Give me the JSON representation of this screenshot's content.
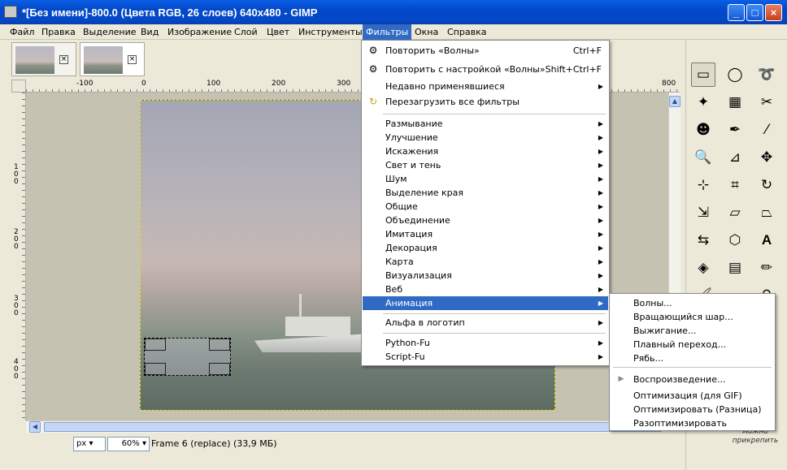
{
  "window": {
    "title": "*[Без имени]-800.0 (Цвета RGB, 26 слоев) 640x480 - GIMP",
    "controls": [
      "_",
      "□",
      "×"
    ]
  },
  "menubar": [
    "Файл",
    "Правка",
    "Выделение",
    "Вид",
    "Изображение",
    "Слой",
    "Цвет",
    "Инструменты",
    "Фильтры",
    "Окна",
    "Справка"
  ],
  "tabs": [
    {
      "close": "×"
    },
    {
      "close": "×"
    }
  ],
  "ruler": {
    "h": [
      "-100",
      "0",
      "100",
      "200",
      "300",
      "800"
    ],
    "v": [
      "100",
      "200",
      "300",
      "400"
    ]
  },
  "status": {
    "unit": "px",
    "zoom": "60%",
    "text": "Frame 6 (replace) (33,9 МБ)"
  },
  "dock_text": "можно прикрепить",
  "filters_menu": {
    "items": [
      {
        "label": "Повторить «Волны»",
        "shortcut": "Ctrl+F",
        "icon": "repeat-icon"
      },
      {
        "label": "Повторить с настройкой «Волны»",
        "shortcut": "Shift+Ctrl+F",
        "icon": "reshow-icon"
      },
      {
        "label": "Недавно применявшиеся",
        "arrow": "▶"
      },
      {
        "label": "Перезагрузить все фильтры",
        "icon": "reload-icon"
      }
    ],
    "categories": [
      "Размывание",
      "Улучшение",
      "Искажения",
      "Свет и тень",
      "Шум",
      "Выделение края",
      "Общие",
      "Объединение",
      "Имитация",
      "Декорация",
      "Карта",
      "Визуализация",
      "Веб",
      "Анимация"
    ],
    "extra": [
      "Альфа в логотип"
    ],
    "scripts": [
      "Python-Fu",
      "Script-Fu"
    ],
    "arrow": "▶"
  },
  "animation_submenu": {
    "group1": [
      "Волны...",
      "Вращающийся шар...",
      "Выжигание...",
      "Плавный переход...",
      "Рябь..."
    ],
    "group2": [
      "Воспроизведение...",
      "Оптимизация (для GIF)",
      "Оптимизировать (Разница)",
      "Разоптимизировать"
    ],
    "play_icon": "▶"
  }
}
